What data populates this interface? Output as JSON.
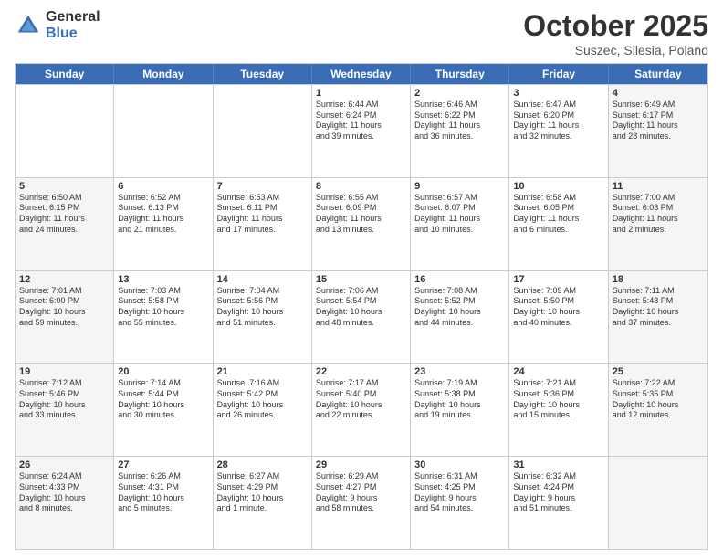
{
  "logo": {
    "general": "General",
    "blue": "Blue"
  },
  "title": "October 2025",
  "location": "Suszec, Silesia, Poland",
  "days": [
    "Sunday",
    "Monday",
    "Tuesday",
    "Wednesday",
    "Thursday",
    "Friday",
    "Saturday"
  ],
  "weeks": [
    [
      {
        "day": "",
        "text": "",
        "shaded": false
      },
      {
        "day": "",
        "text": "",
        "shaded": false
      },
      {
        "day": "",
        "text": "",
        "shaded": false
      },
      {
        "day": "1",
        "text": "Sunrise: 6:44 AM\nSunset: 6:24 PM\nDaylight: 11 hours\nand 39 minutes.",
        "shaded": false
      },
      {
        "day": "2",
        "text": "Sunrise: 6:46 AM\nSunset: 6:22 PM\nDaylight: 11 hours\nand 36 minutes.",
        "shaded": false
      },
      {
        "day": "3",
        "text": "Sunrise: 6:47 AM\nSunset: 6:20 PM\nDaylight: 11 hours\nand 32 minutes.",
        "shaded": false
      },
      {
        "day": "4",
        "text": "Sunrise: 6:49 AM\nSunset: 6:17 PM\nDaylight: 11 hours\nand 28 minutes.",
        "shaded": true
      }
    ],
    [
      {
        "day": "5",
        "text": "Sunrise: 6:50 AM\nSunset: 6:15 PM\nDaylight: 11 hours\nand 24 minutes.",
        "shaded": true
      },
      {
        "day": "6",
        "text": "Sunrise: 6:52 AM\nSunset: 6:13 PM\nDaylight: 11 hours\nand 21 minutes.",
        "shaded": false
      },
      {
        "day": "7",
        "text": "Sunrise: 6:53 AM\nSunset: 6:11 PM\nDaylight: 11 hours\nand 17 minutes.",
        "shaded": false
      },
      {
        "day": "8",
        "text": "Sunrise: 6:55 AM\nSunset: 6:09 PM\nDaylight: 11 hours\nand 13 minutes.",
        "shaded": false
      },
      {
        "day": "9",
        "text": "Sunrise: 6:57 AM\nSunset: 6:07 PM\nDaylight: 11 hours\nand 10 minutes.",
        "shaded": false
      },
      {
        "day": "10",
        "text": "Sunrise: 6:58 AM\nSunset: 6:05 PM\nDaylight: 11 hours\nand 6 minutes.",
        "shaded": false
      },
      {
        "day": "11",
        "text": "Sunrise: 7:00 AM\nSunset: 6:03 PM\nDaylight: 11 hours\nand 2 minutes.",
        "shaded": true
      }
    ],
    [
      {
        "day": "12",
        "text": "Sunrise: 7:01 AM\nSunset: 6:00 PM\nDaylight: 10 hours\nand 59 minutes.",
        "shaded": true
      },
      {
        "day": "13",
        "text": "Sunrise: 7:03 AM\nSunset: 5:58 PM\nDaylight: 10 hours\nand 55 minutes.",
        "shaded": false
      },
      {
        "day": "14",
        "text": "Sunrise: 7:04 AM\nSunset: 5:56 PM\nDaylight: 10 hours\nand 51 minutes.",
        "shaded": false
      },
      {
        "day": "15",
        "text": "Sunrise: 7:06 AM\nSunset: 5:54 PM\nDaylight: 10 hours\nand 48 minutes.",
        "shaded": false
      },
      {
        "day": "16",
        "text": "Sunrise: 7:08 AM\nSunset: 5:52 PM\nDaylight: 10 hours\nand 44 minutes.",
        "shaded": false
      },
      {
        "day": "17",
        "text": "Sunrise: 7:09 AM\nSunset: 5:50 PM\nDaylight: 10 hours\nand 40 minutes.",
        "shaded": false
      },
      {
        "day": "18",
        "text": "Sunrise: 7:11 AM\nSunset: 5:48 PM\nDaylight: 10 hours\nand 37 minutes.",
        "shaded": true
      }
    ],
    [
      {
        "day": "19",
        "text": "Sunrise: 7:12 AM\nSunset: 5:46 PM\nDaylight: 10 hours\nand 33 minutes.",
        "shaded": true
      },
      {
        "day": "20",
        "text": "Sunrise: 7:14 AM\nSunset: 5:44 PM\nDaylight: 10 hours\nand 30 minutes.",
        "shaded": false
      },
      {
        "day": "21",
        "text": "Sunrise: 7:16 AM\nSunset: 5:42 PM\nDaylight: 10 hours\nand 26 minutes.",
        "shaded": false
      },
      {
        "day": "22",
        "text": "Sunrise: 7:17 AM\nSunset: 5:40 PM\nDaylight: 10 hours\nand 22 minutes.",
        "shaded": false
      },
      {
        "day": "23",
        "text": "Sunrise: 7:19 AM\nSunset: 5:38 PM\nDaylight: 10 hours\nand 19 minutes.",
        "shaded": false
      },
      {
        "day": "24",
        "text": "Sunrise: 7:21 AM\nSunset: 5:36 PM\nDaylight: 10 hours\nand 15 minutes.",
        "shaded": false
      },
      {
        "day": "25",
        "text": "Sunrise: 7:22 AM\nSunset: 5:35 PM\nDaylight: 10 hours\nand 12 minutes.",
        "shaded": true
      }
    ],
    [
      {
        "day": "26",
        "text": "Sunrise: 6:24 AM\nSunset: 4:33 PM\nDaylight: 10 hours\nand 8 minutes.",
        "shaded": true
      },
      {
        "day": "27",
        "text": "Sunrise: 6:26 AM\nSunset: 4:31 PM\nDaylight: 10 hours\nand 5 minutes.",
        "shaded": false
      },
      {
        "day": "28",
        "text": "Sunrise: 6:27 AM\nSunset: 4:29 PM\nDaylight: 10 hours\nand 1 minute.",
        "shaded": false
      },
      {
        "day": "29",
        "text": "Sunrise: 6:29 AM\nSunset: 4:27 PM\nDaylight: 9 hours\nand 58 minutes.",
        "shaded": false
      },
      {
        "day": "30",
        "text": "Sunrise: 6:31 AM\nSunset: 4:25 PM\nDaylight: 9 hours\nand 54 minutes.",
        "shaded": false
      },
      {
        "day": "31",
        "text": "Sunrise: 6:32 AM\nSunset: 4:24 PM\nDaylight: 9 hours\nand 51 minutes.",
        "shaded": false
      },
      {
        "day": "",
        "text": "",
        "shaded": true
      }
    ]
  ]
}
